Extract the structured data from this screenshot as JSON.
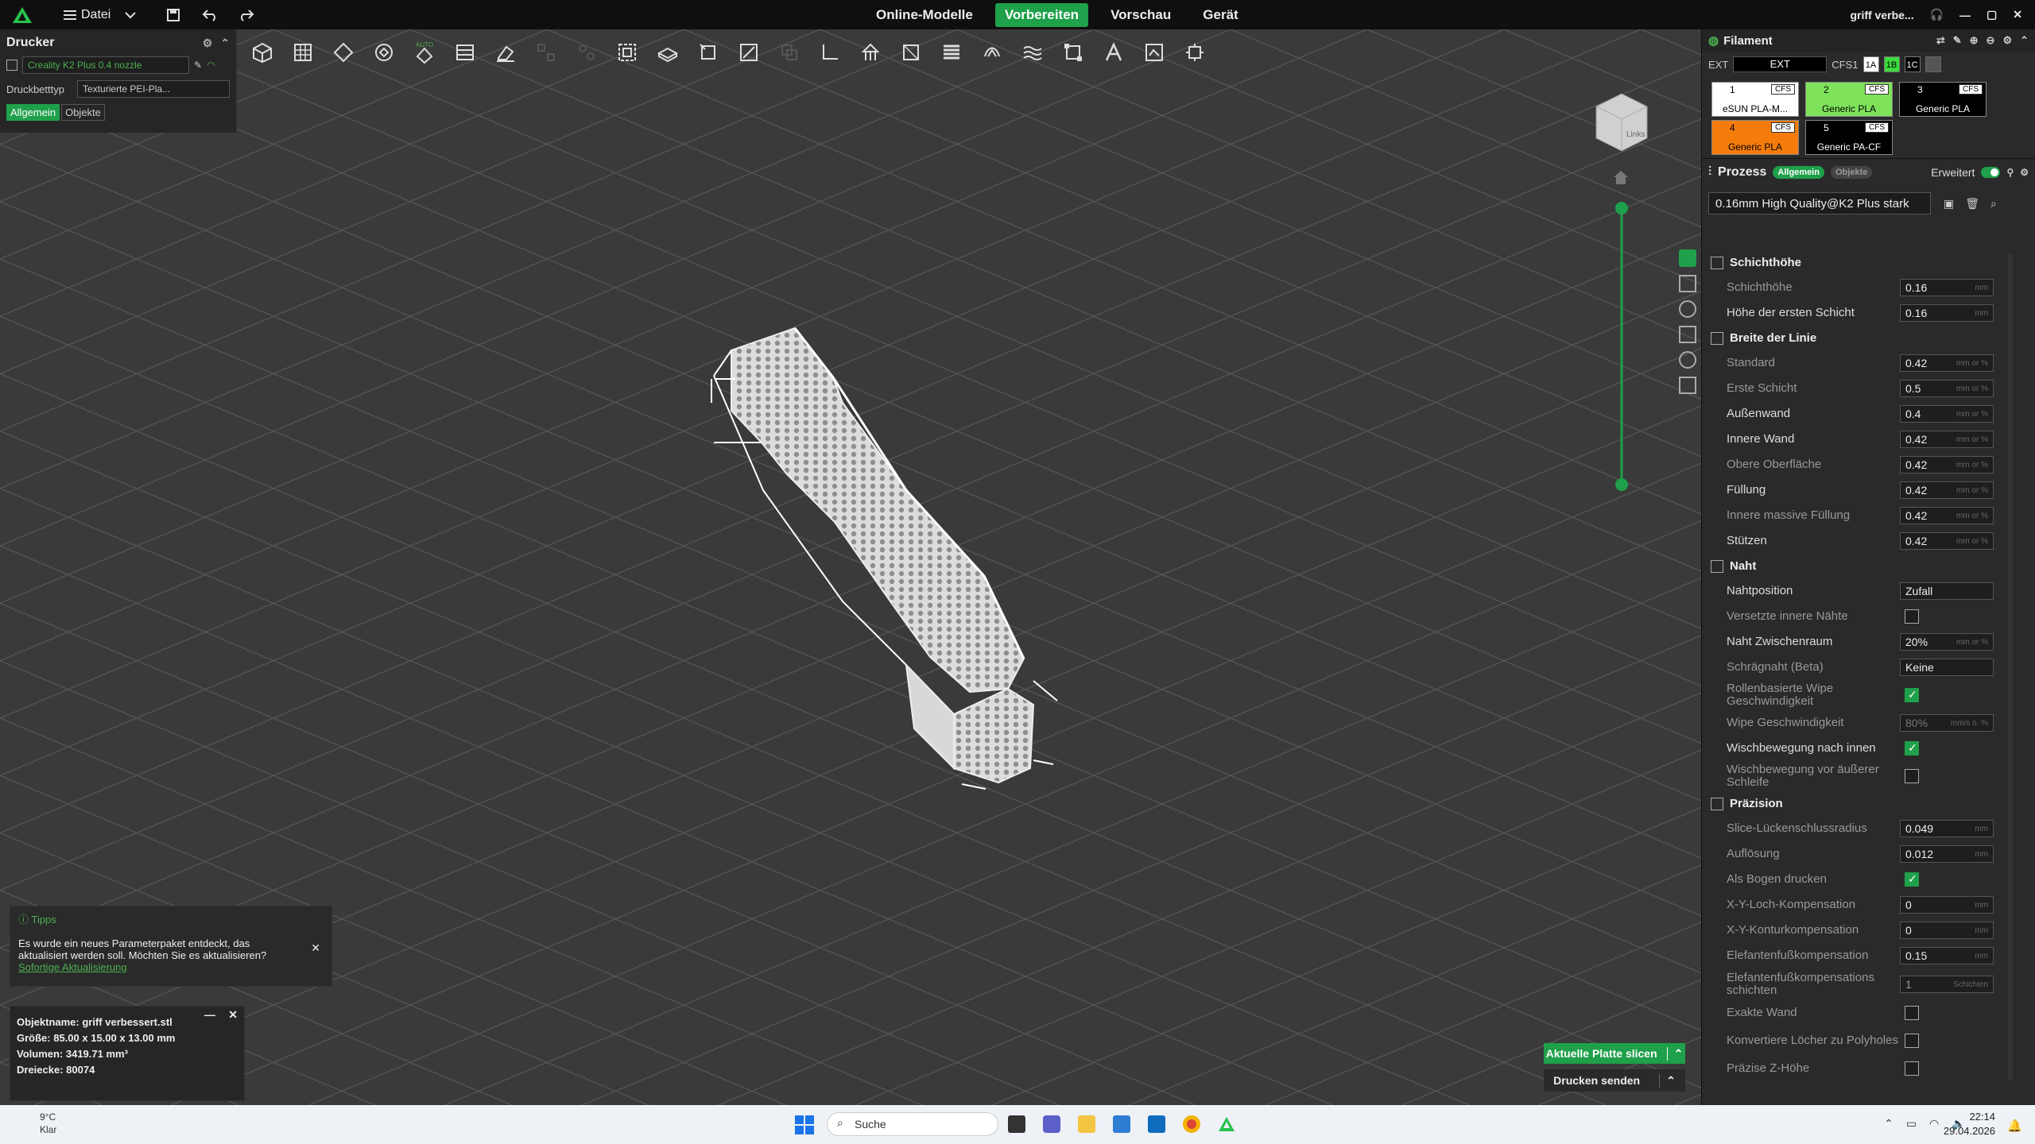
{
  "app": {
    "file_menu": "Datei"
  },
  "nav": {
    "tabs": [
      "Online-Modelle",
      "Vorbereiten",
      "Vorschau",
      "Gerät"
    ],
    "active": "Vorbereiten"
  },
  "user": {
    "name": "griff verbe..."
  },
  "printer": {
    "title": "Drucker",
    "name": "Creality K2 Plus 0.4 nozzle",
    "bed_label": "Druckbetttyp",
    "bed_value": "Texturierte PEI-Pla...",
    "tabs": [
      "Allgemein",
      "Objekte"
    ]
  },
  "filament": {
    "title": "Filament",
    "ext_label": "EXT",
    "ext_value": "EXT",
    "cfs_label": "CFS1",
    "slots": [
      "1A",
      "1B",
      "1C"
    ],
    "items": [
      {
        "num": "1",
        "name": "eSUN PLA-M...",
        "color": "#ffffff",
        "cfs": "CFS"
      },
      {
        "num": "2",
        "name": "Generic PLA",
        "color": "#7ee35a",
        "cfs": "CFS"
      },
      {
        "num": "3",
        "name": "Generic PLA",
        "color": "#000000",
        "cfs": "CFS"
      },
      {
        "num": "4",
        "name": "Generic PLA",
        "color": "#f57c0a",
        "cfs": "CFS"
      },
      {
        "num": "5",
        "name": "Generic PA-CF",
        "color": "#000000",
        "cfs": "CFS"
      }
    ]
  },
  "process": {
    "title": "Prozess",
    "tabs": [
      "Allgemein",
      "Objekte"
    ],
    "advanced_label": "Erweitert",
    "preset": "0.16mm High Quality@K2 Plus stark"
  },
  "settings": {
    "sec_layer": "Schichthöhe",
    "layer_height": {
      "label": "Schichthöhe",
      "value": "0.16",
      "unit": "mm"
    },
    "first_layer": {
      "label": "Höhe der ersten Schicht",
      "value": "0.16",
      "unit": "mm"
    },
    "sec_width": "Breite der Linie",
    "w_standard": {
      "label": "Standard",
      "value": "0.42",
      "unit": "mm or %"
    },
    "w_first": {
      "label": "Erste Schicht",
      "value": "0.5",
      "unit": "mm or %"
    },
    "w_outer": {
      "label": "Außenwand",
      "value": "0.4",
      "unit": "mm or %"
    },
    "w_inner": {
      "label": "Innere Wand",
      "value": "0.42",
      "unit": "mm or %"
    },
    "w_top": {
      "label": "Obere Oberfläche",
      "value": "0.42",
      "unit": "mm or %"
    },
    "w_fill": {
      "label": "Füllung",
      "value": "0.42",
      "unit": "mm or %"
    },
    "w_solid": {
      "label": "Innere massive Füllung",
      "value": "0.42",
      "unit": "mm or %"
    },
    "w_support": {
      "label": "Stützen",
      "value": "0.42",
      "unit": "mm or %"
    },
    "sec_seam": "Naht",
    "seam_pos": {
      "label": "Nahtposition",
      "value": "Zufall"
    },
    "seam_staggered": {
      "label": "Versetzte innere Nähte"
    },
    "seam_gap": {
      "label": "Naht Zwischenraum",
      "value": "20%",
      "unit": "mm or %"
    },
    "seam_scarf": {
      "label": "Schrägnaht (Beta)",
      "value": "Keine"
    },
    "seam_roll": {
      "label": "Rollenbasierte Wipe Geschwindigkeit"
    },
    "wipe_speed": {
      "label": "Wipe Geschwindigkeit",
      "value": "80%",
      "unit": "mm/s o. %"
    },
    "wipe_inward": {
      "label": "Wischbewegung nach innen"
    },
    "wipe_before": {
      "label": "Wischbewegung vor äußerer Schleife"
    },
    "sec_precision": "Präzision",
    "gap_close": {
      "label": "Slice-Lückenschlussradius",
      "value": "0.049",
      "unit": "mm"
    },
    "resolution": {
      "label": "Auflösung",
      "value": "0.012",
      "unit": "mm"
    },
    "arc": {
      "label": "Als Bogen drucken"
    },
    "xy_hole": {
      "label": "X-Y-Loch-Kompensation",
      "value": "0",
      "unit": "mm"
    },
    "xy_contour": {
      "label": "X-Y-Konturkompensation",
      "value": "0",
      "unit": "mm"
    },
    "elephant": {
      "label": "Elefantenfußkompensation",
      "value": "0.15",
      "unit": "mm"
    },
    "elephant_layers": {
      "label": "Elefantenfußkompensations schichten",
      "value": "1",
      "unit": "Schichten"
    },
    "exact_wall": {
      "label": "Exakte Wand"
    },
    "polyholes": {
      "label": "Konvertiere Löcher zu Polyholes"
    },
    "precise_z": {
      "label": "Präzise Z-Höhe"
    }
  },
  "actions": {
    "slice": "Aktuelle Platte slicen",
    "send": "Drucken senden"
  },
  "tips": {
    "title": "Tipps",
    "text": "Es wurde ein neues Parameterpaket entdeckt, das aktualisiert werden soll. Möchten Sie es aktualisieren?",
    "link": "Sofortige Aktualisierung"
  },
  "object": {
    "name": "Objektname: griff verbessert.stl",
    "size": "Größe: 85.00 x 15.00 x 13.00 mm",
    "volume": "Volumen: 3419.71 mm³",
    "triangles": "Dreiecke: 80074"
  },
  "viewcube": {
    "label": "Links"
  },
  "taskbar": {
    "temp": "9°C",
    "weather": "Klar",
    "search": "Suche",
    "time": "22:14",
    "date": "29.04.2026"
  },
  "colors": {
    "accent": "#1fa04a"
  }
}
